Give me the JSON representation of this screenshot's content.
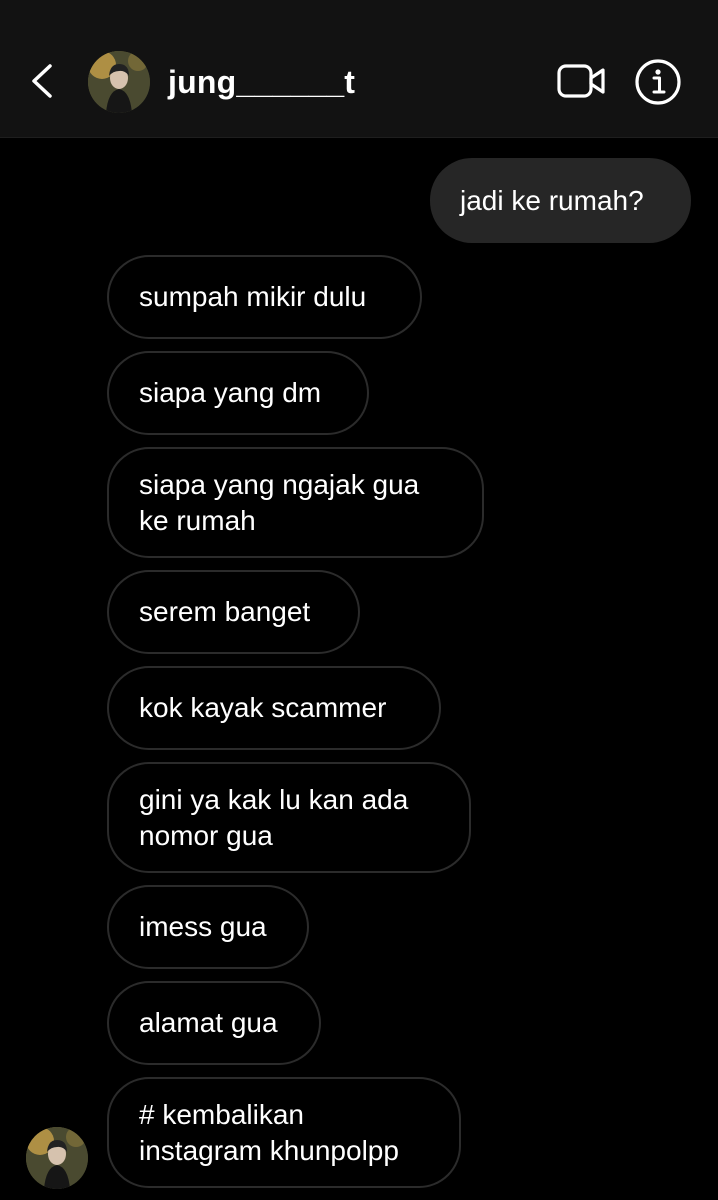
{
  "header": {
    "username": "jung______t",
    "back_icon": "chevron-left-icon",
    "video_icon": "video-call-icon",
    "info_icon": "info-icon"
  },
  "messages": [
    {
      "direction": "outgoing",
      "text": "jadi ke rumah?"
    },
    {
      "direction": "incoming",
      "text": "sumpah mikir dulu"
    },
    {
      "direction": "incoming",
      "text": "siapa yang dm"
    },
    {
      "direction": "incoming",
      "text": "siapa yang ngajak gua\nke rumah"
    },
    {
      "direction": "incoming",
      "text": "serem banget"
    },
    {
      "direction": "incoming",
      "text": "kok kayak scammer"
    },
    {
      "direction": "incoming",
      "text": "gini ya kak lu kan ada\nnomor gua"
    },
    {
      "direction": "incoming",
      "text": "imess gua"
    },
    {
      "direction": "incoming",
      "text": "alamat gua"
    },
    {
      "direction": "incoming",
      "text": "# kembalikan\ninstagram khunpolpp"
    }
  ],
  "colors": {
    "background": "#000000",
    "header": "#121212",
    "outgoing_bubble": "#262626",
    "incoming_border": "#2b2b2b",
    "text": "#ffffff"
  }
}
